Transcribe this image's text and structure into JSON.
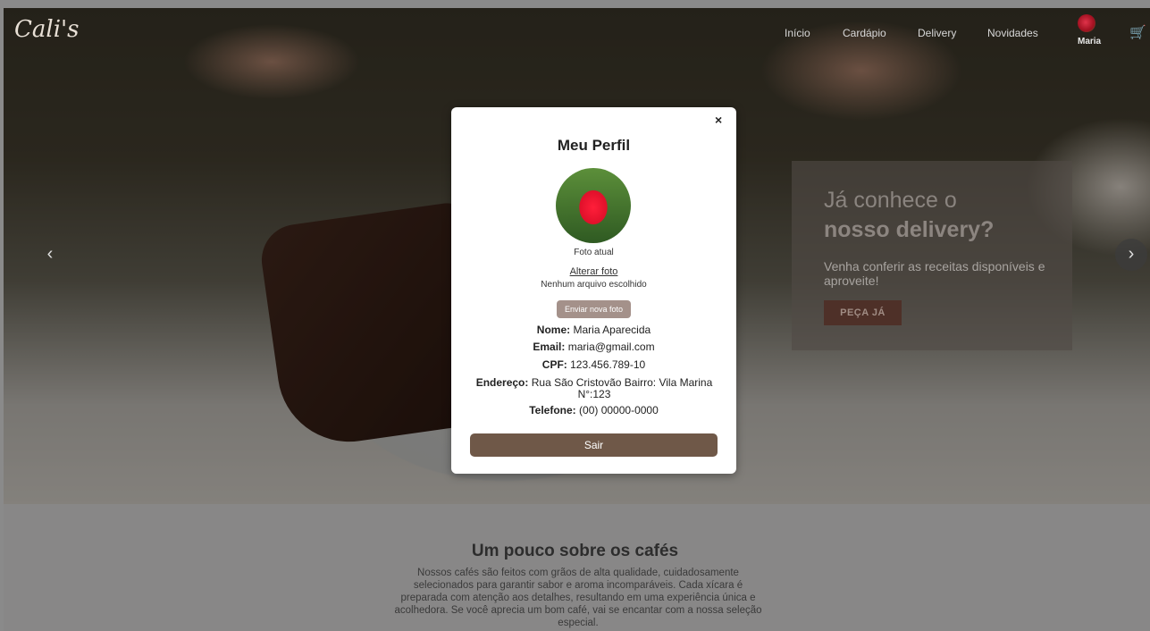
{
  "header": {
    "logo": "Cali's",
    "nav": [
      "Início",
      "Cardápio",
      "Delivery",
      "Novidades"
    ],
    "user_name": "Maria"
  },
  "carousel": {
    "promo_title_line1": "Já conhece o",
    "promo_title_line2": "nosso delivery?",
    "promo_text": "Venha conferir as receitas disponíveis e aproveite!",
    "promo_button": "PEÇA JÁ"
  },
  "about": {
    "title": "Um pouco sobre os cafés",
    "text": "Nossos cafés são feitos com grãos de alta qualidade, cuidadosamente selecionados para garantir sabor e aroma incomparáveis. Cada xícara é preparada com atenção aos detalhes, resultando em uma experiência única e acolhedora. Se você aprecia um bom café, vai se encantar com a nossa seleção especial."
  },
  "modal": {
    "close": "×",
    "title": "Meu Perfil",
    "photo_caption": "Foto atual",
    "change_photo": "Alterar foto",
    "no_file": "Nenhum arquivo escolhido",
    "upload_button": "Enviar nova foto",
    "fields": {
      "name_label": "Nome:",
      "name": "Maria Aparecida",
      "email_label": "Email:",
      "email": "maria@gmail.com",
      "cpf_label": "CPF:",
      "cpf": "123.456.789-10",
      "address_label": "Endereço:",
      "address": "Rua São Cristovão Bairro: Vila Marina N°:123",
      "phone_label": "Telefone:",
      "phone": "(00) 00000-0000"
    },
    "logout_button": "Sair"
  }
}
